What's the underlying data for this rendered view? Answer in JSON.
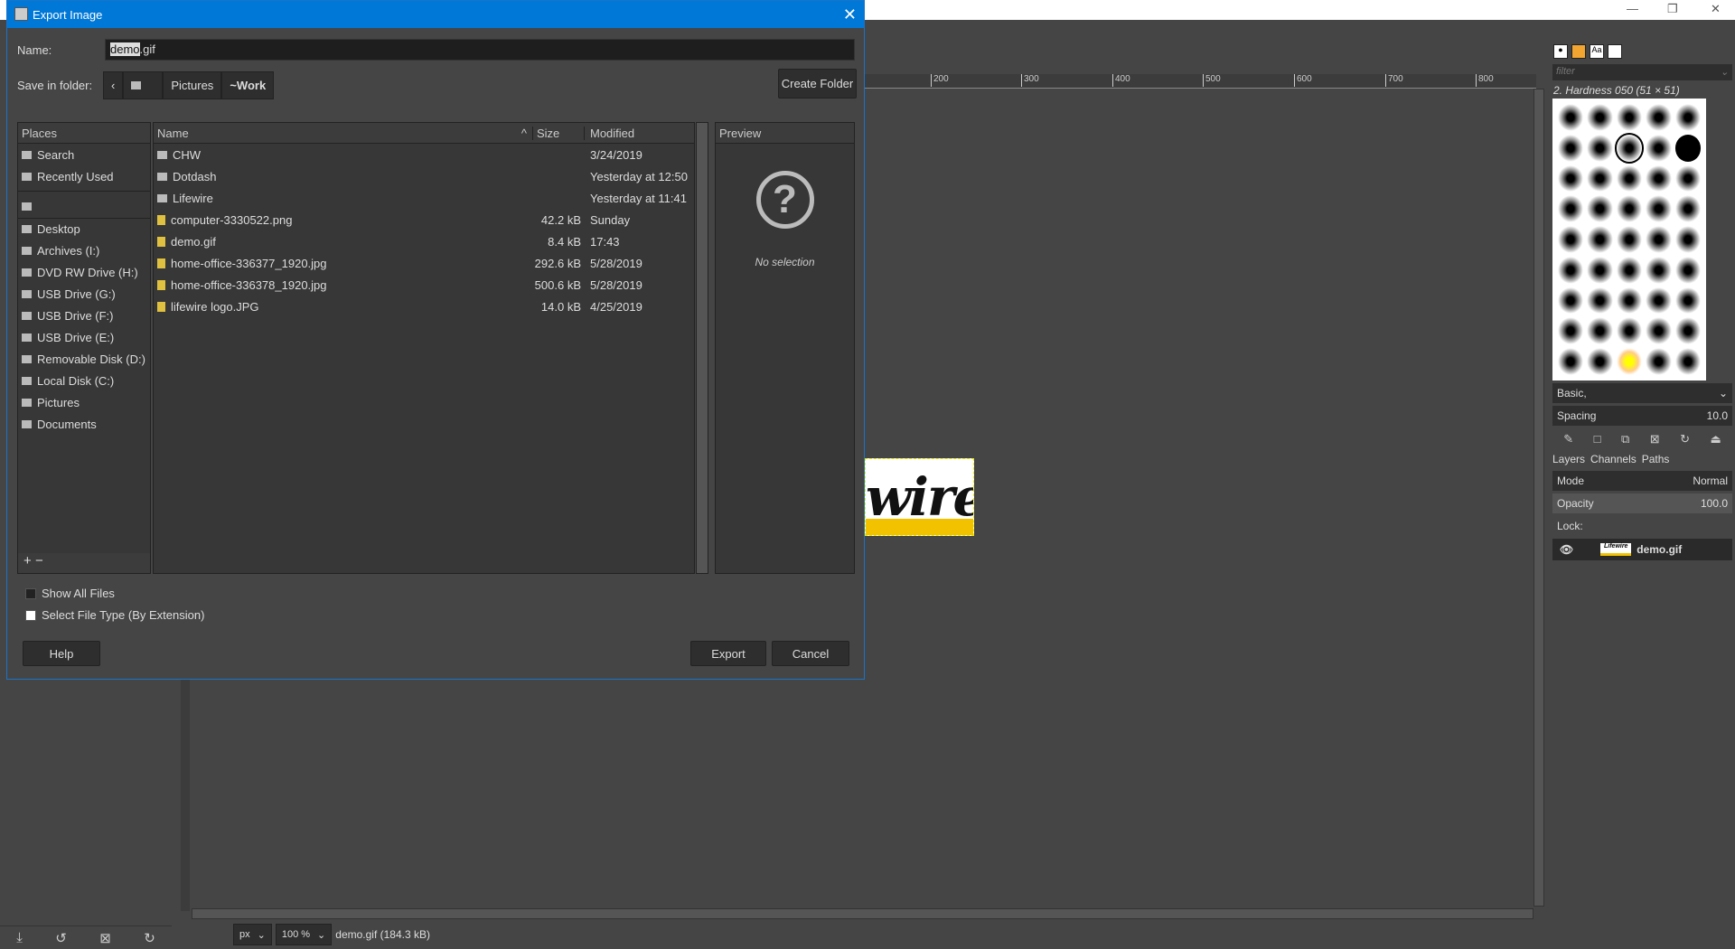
{
  "dialog": {
    "title": "Export Image",
    "name_label": "Name:",
    "name_value_selected": "demo",
    "name_value_rest": ".gif",
    "save_label": "Save in folder:",
    "crumbs": [
      "Pictures",
      "~Work"
    ],
    "create_folder": "Create Folder",
    "places_header": "Places",
    "places": [
      "Search",
      "Recently Used",
      "",
      "Desktop",
      "Archives (I:)",
      "DVD RW Drive (H:)",
      "USB Drive (G:)",
      "USB Drive (F:)",
      "USB Drive (E:)",
      "Removable Disk (D:)",
      "Local Disk (C:)",
      "Pictures",
      "Documents"
    ],
    "columns": {
      "name": "Name",
      "size": "Size",
      "modified": "Modified"
    },
    "files": [
      {
        "name": "CHW",
        "size": "",
        "modified": "3/24/2019",
        "type": "folder"
      },
      {
        "name": "Dotdash",
        "size": "",
        "modified": "Yesterday at 12:50",
        "type": "folder"
      },
      {
        "name": "Lifewire",
        "size": "",
        "modified": "Yesterday at 11:41",
        "type": "folder"
      },
      {
        "name": "computer-3330522.png",
        "size": "42.2 kB",
        "modified": "Sunday",
        "type": "image"
      },
      {
        "name": "demo.gif",
        "size": "8.4 kB",
        "modified": "17:43",
        "type": "image"
      },
      {
        "name": "home-office-336377_1920.jpg",
        "size": "292.6 kB",
        "modified": "5/28/2019",
        "type": "image"
      },
      {
        "name": "home-office-336378_1920.jpg",
        "size": "500.6 kB",
        "modified": "5/28/2019",
        "type": "image"
      },
      {
        "name": "lifewire logo.JPG",
        "size": "14.0 kB",
        "modified": "4/25/2019",
        "type": "image"
      }
    ],
    "preview_header": "Preview",
    "preview_empty": "No selection",
    "show_all": "Show All Files",
    "select_type": "Select File Type (By Extension)",
    "help": "Help",
    "export": "Export",
    "cancel": "Cancel"
  },
  "canvas": {
    "ruler": [
      "200",
      "300",
      "400",
      "500",
      "600",
      "700",
      "800"
    ],
    "logo_text": "wire",
    "logo": "Lifewire"
  },
  "status": {
    "unit": "px",
    "zoom": "100 %",
    "file": "demo.gif (184.3 kB)"
  },
  "dock": {
    "filter": "filter",
    "brush": "2. Hardness 050 (51 × 51)",
    "preset": "Basic,",
    "spacing_label": "Spacing",
    "spacing": "10.0",
    "tabs": [
      "Layers",
      "Channels",
      "Paths"
    ],
    "mode_label": "Mode",
    "mode": "Normal",
    "opacity_label": "Opacity",
    "opacity": "100.0",
    "lock": "Lock:",
    "layer": "demo.gif"
  },
  "colors": {
    "titlebar": "#0078d7",
    "bg": "#454545"
  }
}
